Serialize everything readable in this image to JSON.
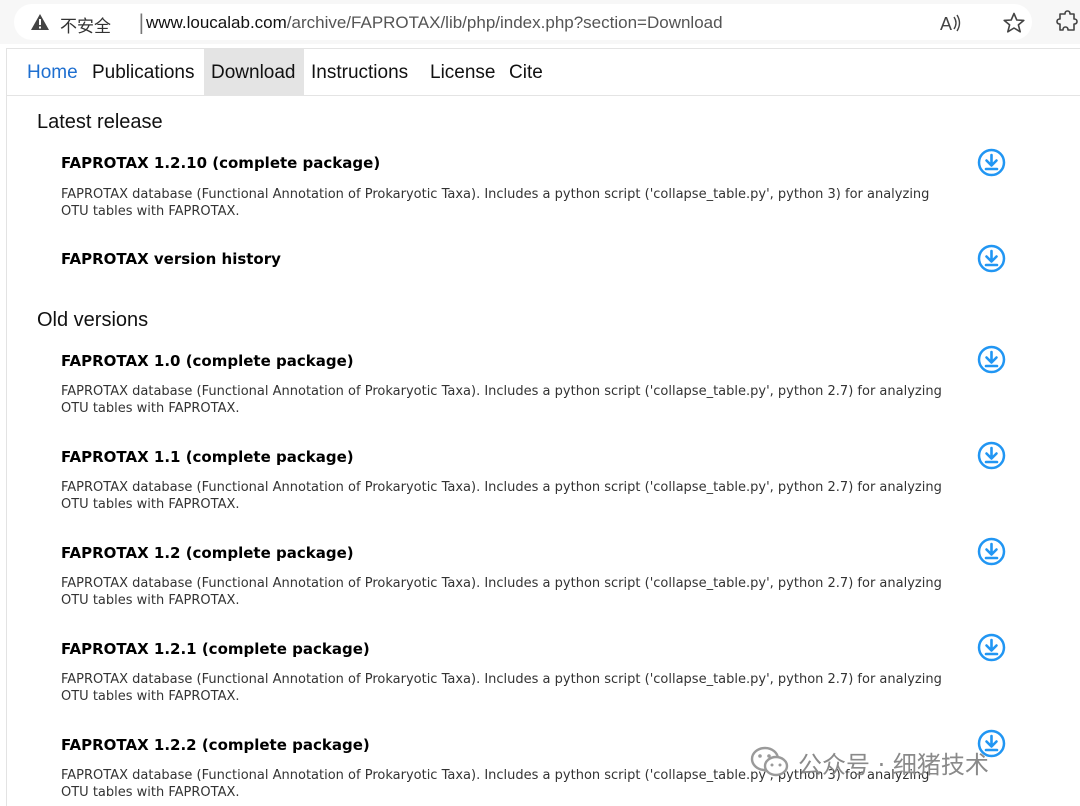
{
  "browser": {
    "security_label": "不安全",
    "separator": "|",
    "url_host": "www.loucalab.com",
    "url_path": "/archive/FAPROTAX/lib/php/index.php?section=Download"
  },
  "nav": {
    "items": [
      {
        "label": "Home"
      },
      {
        "label": "Publications"
      },
      {
        "label": "Download"
      },
      {
        "label": "Instructions"
      },
      {
        "label": "License"
      },
      {
        "label": "Cite"
      }
    ],
    "active": "Download"
  },
  "sections": {
    "latest": {
      "title": "Latest release",
      "items": [
        {
          "title": "FAPROTAX 1.2.10 (complete package)",
          "desc": "FAPROTAX database (Functional Annotation of Prokaryotic Taxa). Includes a python script ('collapse_table.py', python 3) for analyzing OTU tables with FAPROTAX."
        },
        {
          "title": "FAPROTAX version history",
          "desc": ""
        }
      ]
    },
    "old": {
      "title": "Old versions",
      "items": [
        {
          "title": "FAPROTAX 1.0 (complete package)",
          "desc": "FAPROTAX database (Functional Annotation of Prokaryotic Taxa). Includes a python script ('collapse_table.py', python 2.7) for analyzing OTU tables with FAPROTAX."
        },
        {
          "title": "FAPROTAX 1.1 (complete package)",
          "desc": "FAPROTAX database (Functional Annotation of Prokaryotic Taxa). Includes a python script ('collapse_table.py', python 2.7) for analyzing OTU tables with FAPROTAX."
        },
        {
          "title": "FAPROTAX 1.2 (complete package)",
          "desc": "FAPROTAX database (Functional Annotation of Prokaryotic Taxa). Includes a python script ('collapse_table.py', python 2.7) for analyzing OTU tables with FAPROTAX."
        },
        {
          "title": "FAPROTAX 1.2.1 (complete package)",
          "desc": "FAPROTAX database (Functional Annotation of Prokaryotic Taxa). Includes a python script ('collapse_table.py', python 2.7) for analyzing OTU tables with FAPROTAX."
        },
        {
          "title": "FAPROTAX 1.2.2 (complete package)",
          "desc": "FAPROTAX database (Functional Annotation of Prokaryotic Taxa). Includes a python script ('collapse_table.py', python 3) for analyzing OTU tables with FAPROTAX."
        }
      ]
    }
  },
  "watermark": {
    "text": "公众号 · 细猪技术"
  },
  "colors": {
    "accent_blue": "#1e6fd0",
    "download_icon": "#2196f3",
    "active_tab_bg": "#e4e4e4"
  },
  "icons": {
    "security": "warning-triangle-icon",
    "read_aloud": "read-aloud-icon",
    "favorite": "star-icon",
    "extensions": "puzzle-icon",
    "download": "download-circle-icon"
  }
}
